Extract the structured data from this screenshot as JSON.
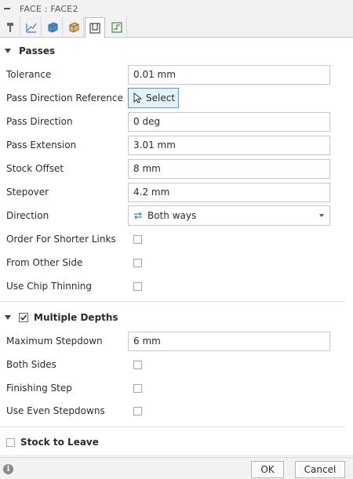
{
  "window": {
    "title": "FACE : FACE2"
  },
  "tabs": [
    {
      "name": "tool-tab"
    },
    {
      "name": "geometry-tab"
    },
    {
      "name": "heights-tab"
    },
    {
      "name": "stock-tab"
    },
    {
      "name": "passes-tab",
      "active": true
    },
    {
      "name": "linking-tab"
    }
  ],
  "passes": {
    "header": "Passes",
    "tolerance": {
      "label": "Tolerance",
      "value": "0.01 mm"
    },
    "pass_direction_reference": {
      "label": "Pass Direction Reference",
      "button": "Select"
    },
    "pass_direction": {
      "label": "Pass Direction",
      "value": "0 deg"
    },
    "pass_extension": {
      "label": "Pass Extension",
      "value": "3.01 mm"
    },
    "stock_offset": {
      "label": "Stock Offset",
      "value": "8 mm"
    },
    "stepover": {
      "label": "Stepover",
      "value": "4.2 mm"
    },
    "direction": {
      "label": "Direction",
      "value": "Both ways"
    },
    "order_for_shorter_links": {
      "label": "Order For Shorter Links",
      "checked": false
    },
    "from_other_side": {
      "label": "From Other Side",
      "checked": false
    },
    "use_chip_thinning": {
      "label": "Use Chip Thinning",
      "checked": false
    }
  },
  "multiple_depths": {
    "header": "Multiple Depths",
    "checked": true,
    "maximum_stepdown": {
      "label": "Maximum Stepdown",
      "value": "6 mm"
    },
    "both_sides": {
      "label": "Both Sides",
      "checked": false
    },
    "finishing_step": {
      "label": "Finishing Step",
      "checked": false
    },
    "use_even_stepdowns": {
      "label": "Use Even Stepdowns",
      "checked": false
    }
  },
  "stock_to_leave": {
    "label": "Stock to Leave",
    "checked": false
  },
  "footer": {
    "ok": "OK",
    "cancel": "Cancel"
  },
  "colors": {
    "accent": "#4a9fd6",
    "select_bg": "#e3f1fb"
  }
}
